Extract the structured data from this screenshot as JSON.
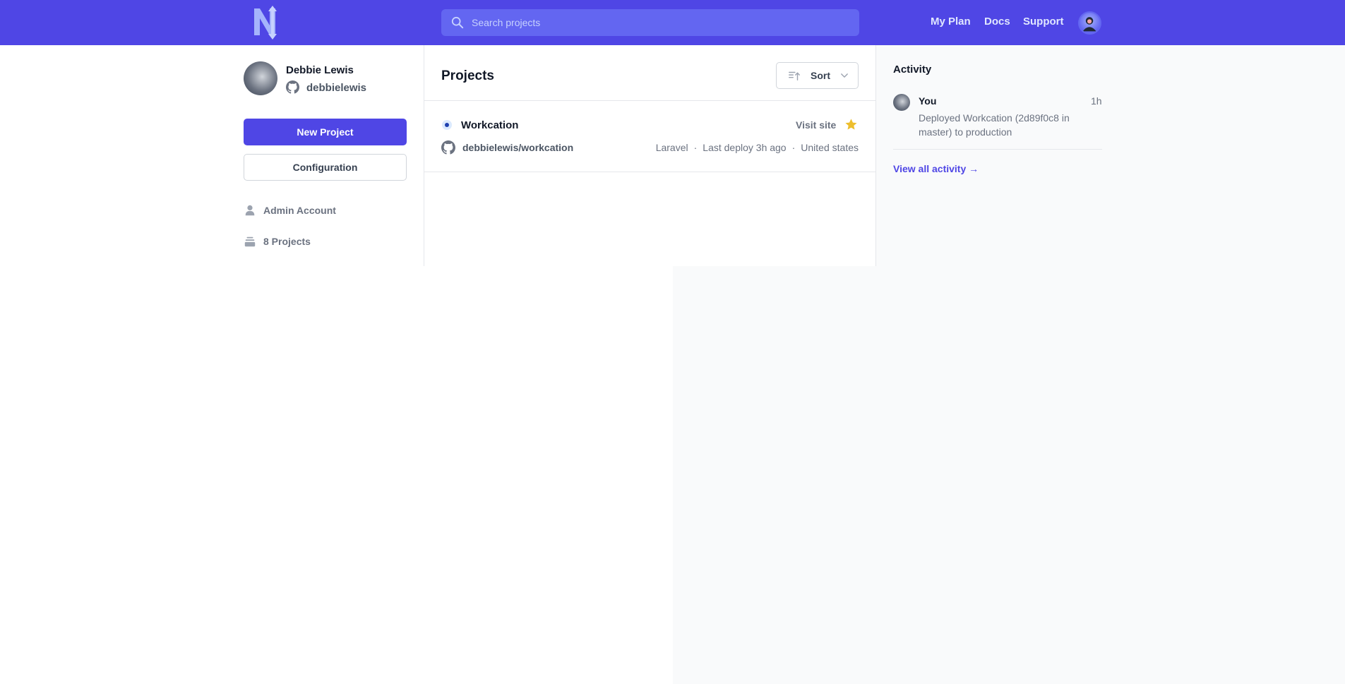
{
  "colors": {
    "brand": "#4f46e5",
    "brand_light": "#6366f1",
    "star": "#eab308"
  },
  "header": {
    "search_placeholder": "Search projects",
    "links": [
      "My Plan",
      "Docs",
      "Support"
    ]
  },
  "profile": {
    "name": "Debbie Lewis",
    "handle": "debbielewis",
    "new_project_label": "New Project",
    "configuration_label": "Configuration",
    "account_label": "Admin Account",
    "projects_count_label": "8 Projects"
  },
  "projects": {
    "title": "Projects",
    "sort_label": "Sort",
    "items": [
      {
        "name": "Workcation",
        "visit_label": "Visit site",
        "repo": "debbielewis/workcation",
        "framework": "Laravel",
        "last_deploy": "Last deploy 3h ago",
        "region": "United states",
        "starred": true
      }
    ]
  },
  "activity": {
    "title": "Activity",
    "items": [
      {
        "user": "You",
        "time": "1h",
        "description": "Deployed Workcation (2d89f0c8 in master) to production"
      }
    ],
    "view_all_label": "View all activity →"
  }
}
